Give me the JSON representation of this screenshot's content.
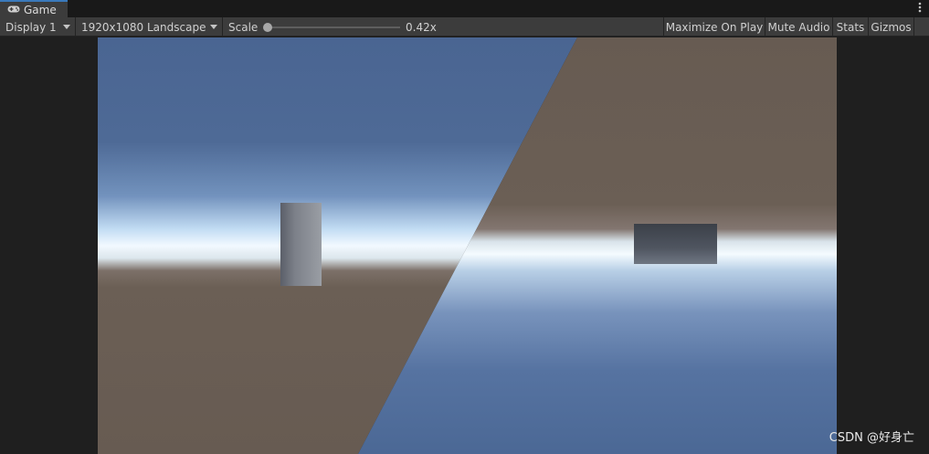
{
  "window": {
    "tab_title": "Game",
    "tab_icon": "gamepad-icon",
    "menu_icon": "kebab-menu-icon"
  },
  "toolbar": {
    "display": "Display 1",
    "resolution": "1920x1080 Landscape",
    "scale_label": "Scale",
    "scale_value": "0.42x",
    "scale_fraction": 0.0,
    "maximize_on_play": "Maximize On Play",
    "mute_audio": "Mute Audio",
    "stats": "Stats",
    "gizmos": "Gizmos"
  },
  "scene": {
    "sky_color": "#4a6da0",
    "horizon_color": "#eef6ff",
    "ground_color": "#6b5f55",
    "objects": [
      "cylinder",
      "box"
    ]
  },
  "watermark": "CSDN @好身亡",
  "colors": {
    "editor_bg": "#1f1f1f",
    "toolbar_bg": "#3c3c3c",
    "tab_accent": "#3a79bb"
  }
}
